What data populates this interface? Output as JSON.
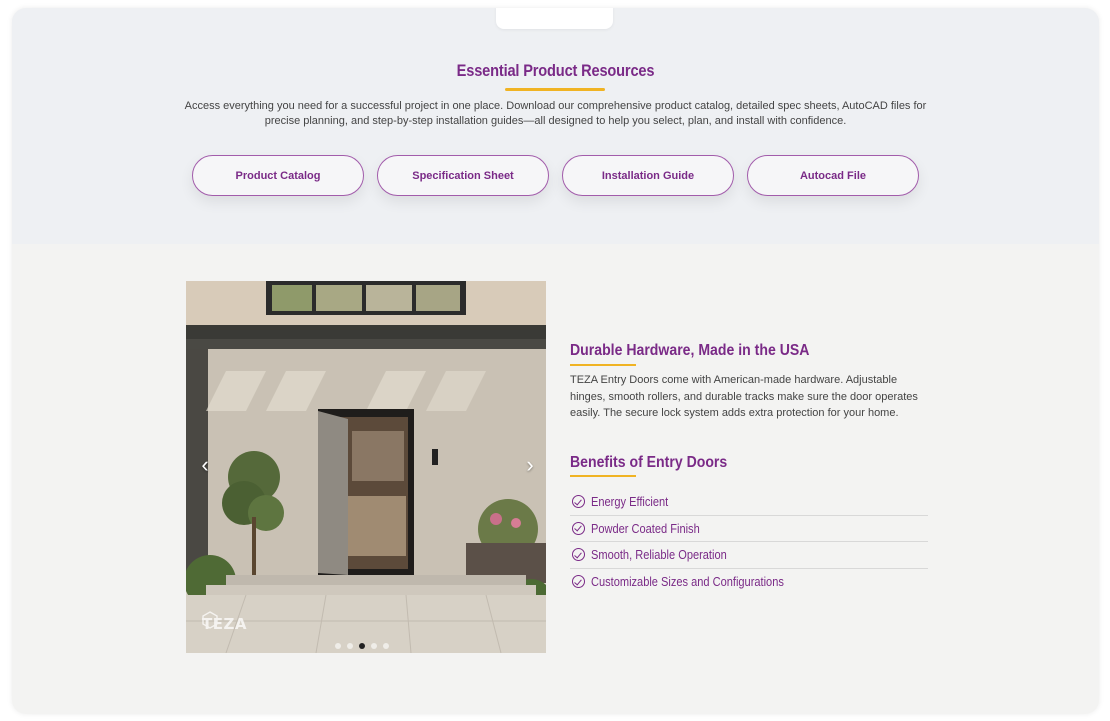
{
  "resources": {
    "title": "Essential Product Resources",
    "description": "Access everything you need for a successful project in one place. Download our comprehensive product catalog, detailed spec sheets, AutoCAD files for precise planning, and step-by-step installation guides—all designed to help you select, plan, and install with confidence.",
    "buttons": [
      "Product Catalog",
      "Specification Sheet",
      "Installation Guide",
      "Autocad File"
    ]
  },
  "slider": {
    "prev_icon": "chevron-left-icon",
    "next_icon": "chevron-right-icon",
    "logo_text": "TEZA",
    "dots_total": 5,
    "active_dot": 3
  },
  "feature": {
    "heading": "Durable Hardware, Made in the USA",
    "paragraph": "TEZA Entry Doors come with American-made hardware. Adjustable hinges, smooth rollers, and durable tracks make sure the door operates easily. The secure lock system adds extra protection for your home.",
    "benefits_heading": "Benefits of Entry Doors",
    "benefits": [
      "Energy Efficient",
      "Powder Coated Finish",
      "Smooth, Reliable Operation",
      "Customizable Sizes and Configurations"
    ]
  },
  "colors": {
    "brand_purple": "#7a2a87",
    "accent_gold": "#f0b323",
    "section_top_bg": "#eef0f3",
    "section_bottom_bg": "#f3f3f2"
  }
}
